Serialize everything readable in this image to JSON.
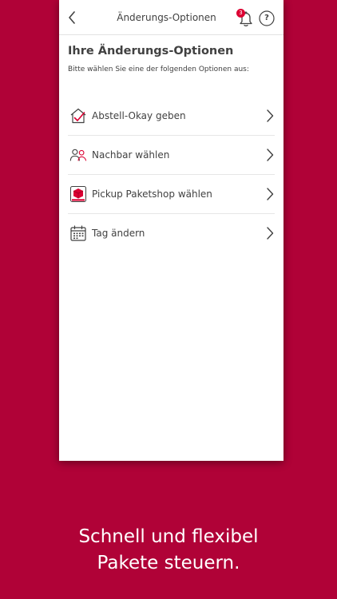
{
  "header": {
    "title": "Änderungs-Optionen",
    "notification_count": "3",
    "help_label": "?"
  },
  "main": {
    "heading": "Ihre Änderungs-Optionen",
    "subtitle": "Bitte wählen Sie eine der folgenden Optionen aus:",
    "options": [
      {
        "label": "Abstell-Okay geben",
        "icon": "house-check-icon"
      },
      {
        "label": "Nachbar wählen",
        "icon": "neighbors-icon"
      },
      {
        "label": "Pickup Paketshop wählen",
        "icon": "pickup-shop-icon"
      },
      {
        "label": "Tag ändern",
        "icon": "calendar-icon"
      }
    ]
  },
  "tagline": {
    "line1": "Schnell und flexibel",
    "line2": "Pakete steuern."
  },
  "colors": {
    "brand_red": "#dc0032",
    "background": "#b00237",
    "text": "#414141"
  }
}
